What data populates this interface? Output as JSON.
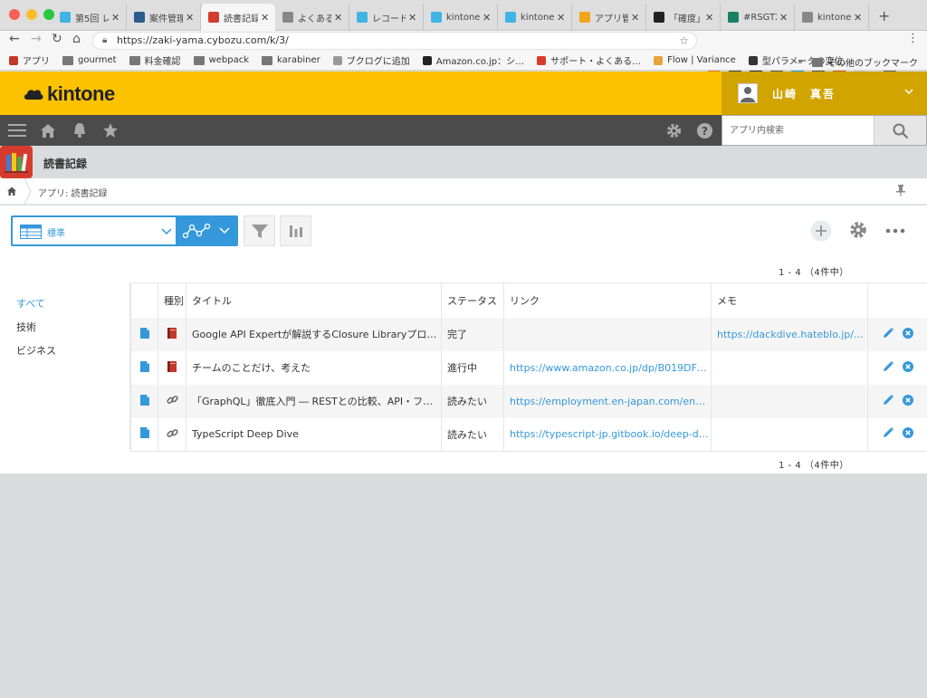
{
  "browser": {
    "tabs": [
      {
        "label": "第5回 レ",
        "icon": "cybozu-icon",
        "color": "#3fb4e5"
      },
      {
        "label": "案件管理",
        "icon": "kintone-app-icon",
        "color": "#2d5a8c"
      },
      {
        "label": "読書記録",
        "icon": "reading-app-icon",
        "color": "#d63c2e",
        "active": true
      },
      {
        "label": "よくある",
        "icon": "document-icon",
        "color": "#888888"
      },
      {
        "label": "レコード",
        "icon": "cybozu-icon",
        "color": "#3fb4e5"
      },
      {
        "label": "kintone",
        "icon": "cybozu-icon",
        "color": "#3fb4e5"
      },
      {
        "label": "kintone",
        "icon": "cybozu-icon",
        "color": "#3fb4e5"
      },
      {
        "label": "アプリ管",
        "icon": "app-manage-icon",
        "color": "#f2a51a"
      },
      {
        "label": "「確度」",
        "icon": "github-icon",
        "color": "#222222"
      },
      {
        "label": "#RSGT2",
        "icon": "sj-icon",
        "color": "#1a7f64"
      },
      {
        "label": "kintone",
        "icon": "box-icon",
        "color": "#888888"
      }
    ],
    "url": "https://zaki-yama.cybozu.com/k/3/",
    "bookmarks": [
      {
        "label": "アプリ",
        "icon": "apps-grid-icon"
      },
      {
        "label": "gourmet",
        "icon": "folder-icon"
      },
      {
        "label": "料金確認",
        "icon": "folder-icon"
      },
      {
        "label": "webpack",
        "icon": "folder-icon"
      },
      {
        "label": "karabiner",
        "icon": "folder-icon"
      },
      {
        "label": "ブクログに追加",
        "icon": "page-icon"
      },
      {
        "label": "Amazon.co.jp：シ…",
        "icon": "amazon-icon"
      },
      {
        "label": "サポート・よくある…",
        "icon": "support-icon"
      },
      {
        "label": "Flow | Variance",
        "icon": "flow-icon"
      },
      {
        "label": "型パラメータの変位…",
        "icon": "d-icon"
      }
    ],
    "bookmarks_more": "»",
    "bookmarks_other": "その他のブックマーク"
  },
  "header": {
    "logo_text": "kintone",
    "user_name": "山崎　真吾",
    "search_placeholder": "アプリ内検索"
  },
  "app": {
    "title": "読書記録",
    "breadcrumb": "アプリ: 読書記録"
  },
  "toolbar": {
    "view_name": "標準"
  },
  "pagination": {
    "top": "1 - 4 （4件中）",
    "bottom": "1 - 4 （4件中）"
  },
  "categories": [
    {
      "label": "すべて",
      "active": true
    },
    {
      "label": "技術",
      "active": false
    },
    {
      "label": "ビジネス",
      "active": false
    }
  ],
  "table": {
    "headers": {
      "kind": "種別",
      "title": "タイトル",
      "status": "ステータス",
      "link": "リンク",
      "memo": "メモ"
    },
    "rows": [
      {
        "kind_icon": "book-icon",
        "title": "Google API Expertが解説するClosure Libraryプログ…",
        "status": "完了",
        "link": "",
        "memo": "https://dackdive.hateblo.jp/e…"
      },
      {
        "kind_icon": "book-icon",
        "title": "チームのことだけ、考えた",
        "status": "進行中",
        "link": "https://www.amazon.co.jp/dp/B019DFS…",
        "memo": ""
      },
      {
        "kind_icon": "link-icon",
        "title": "「GraphQL」徹底入門 ― RESTとの比較、API・フロ…",
        "status": "読みたい",
        "link": "https://employment.en-japan.com/engi…",
        "memo": ""
      },
      {
        "kind_icon": "link-icon",
        "title": "TypeScript Deep Dive",
        "status": "読みたい",
        "link": "https://typescript-jp.gitbook.io/deep-di…",
        "memo": ""
      }
    ]
  },
  "colors": {
    "brand": "#fcc200",
    "brand_dark": "#d2a400",
    "nav": "#4b4b4b",
    "accent": "#3498db",
    "app_icon": "#d63c2e"
  }
}
